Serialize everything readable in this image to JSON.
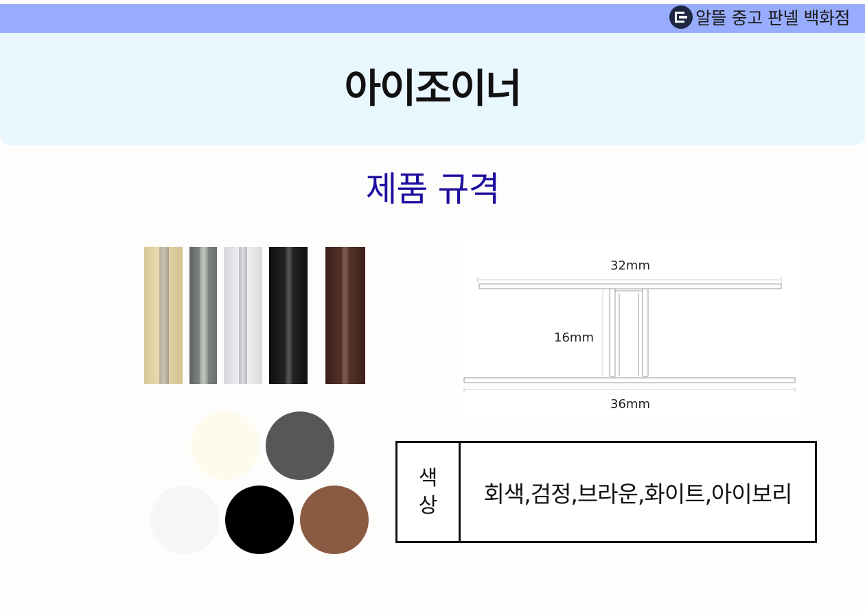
{
  "brand": {
    "name": "알뜰 중고 판넬 백화점",
    "logo_icon": "shop-logo-icon"
  },
  "header": {
    "title": "아이조이너"
  },
  "section": {
    "title": "제품 규격"
  },
  "diagram": {
    "top_width": "32mm",
    "height": "16mm",
    "bottom_width": "36mm"
  },
  "spec": {
    "label_line1": "색",
    "label_line2": "상",
    "value": "회색,검정,브라운,화이트,아이보리"
  },
  "colors": {
    "topbar": "#98acfe",
    "header_panel": "#e9f7ff",
    "section_title": "#1f0fa0",
    "product_ivory": "#e2d4a6",
    "product_gray": "#7c807c",
    "product_white": "#e8e8ea",
    "product_black": "#1a1a1a",
    "product_brown": "#4a2a22",
    "swatch_ivory": "#fffaee",
    "swatch_gray": "#575757",
    "swatch_white": "#f6f6f4",
    "swatch_black": "#000000",
    "swatch_brown": "#8b5a42"
  }
}
